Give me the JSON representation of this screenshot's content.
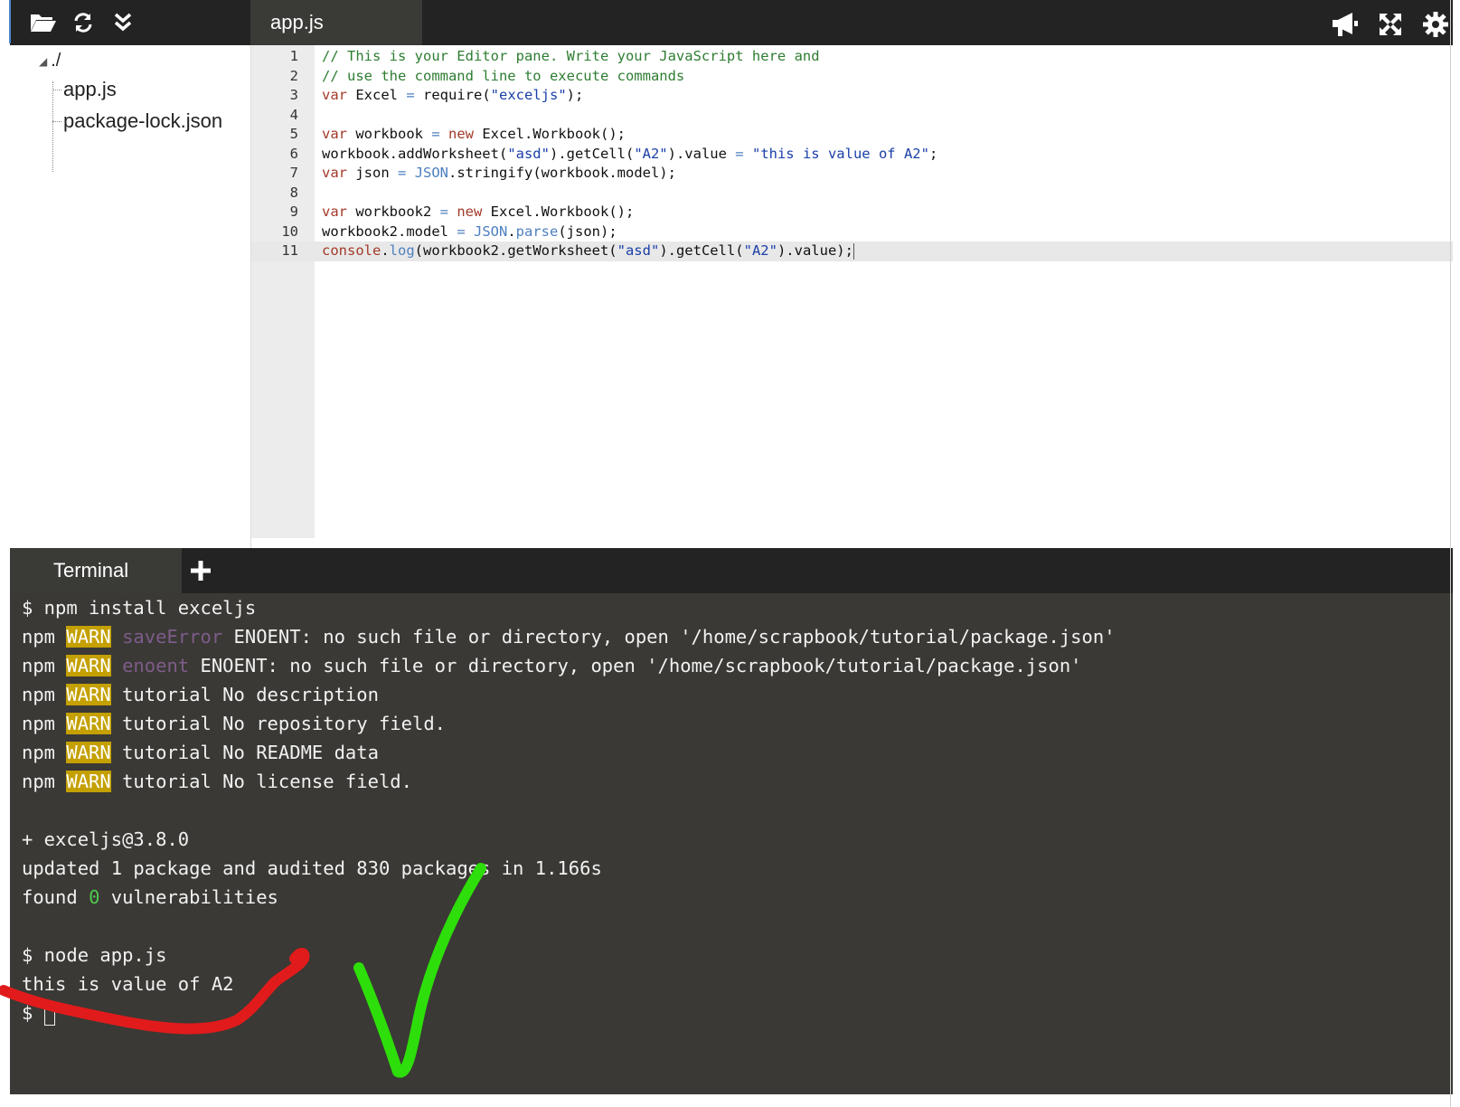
{
  "window": {
    "toolbar_icons": [
      "folder-open-icon",
      "refresh-icon",
      "collapse-down-icon"
    ],
    "top_actions": [
      "megaphone-icon",
      "fullscreen-icon",
      "settings-icon"
    ]
  },
  "editor_tab": {
    "label": "app.js"
  },
  "file_tree": {
    "root": "./",
    "items": [
      "app.js",
      "package-lock.json"
    ]
  },
  "editor": {
    "lines": [
      {
        "n": "1",
        "text": "// This is your Editor pane. Write your JavaScript here and"
      },
      {
        "n": "2",
        "text": "// use the command line to execute commands"
      },
      {
        "n": "3",
        "text": "var Excel = require(\"exceljs\");"
      },
      {
        "n": "4",
        "text": ""
      },
      {
        "n": "5",
        "text": "var workbook = new Excel.Workbook();"
      },
      {
        "n": "6",
        "text": "workbook.addWorksheet(\"asd\").getCell(\"A2\").value = \"this is value of A2\";"
      },
      {
        "n": "7",
        "text": "var json = JSON.stringify(workbook.model);"
      },
      {
        "n": "8",
        "text": ""
      },
      {
        "n": "9",
        "text": "var workbook2 = new Excel.Workbook();"
      },
      {
        "n": "10",
        "text": "workbook2.model = JSON.parse(json);"
      },
      {
        "n": "11",
        "text": "console.log(workbook2.getWorksheet(\"asd\").getCell(\"A2\").value);"
      }
    ],
    "active_line": "11"
  },
  "terminal": {
    "tab_label": "Terminal",
    "add_label": "+",
    "lines": {
      "l1": "$ npm install exceljs",
      "npm": "npm",
      "warn": "WARN",
      "l2_dim": "saveError",
      "l2_rest": " ENOENT: no such file or directory, open '/home/scrapbook/tutorial/package.json'",
      "l3_dim": "enoent",
      "l3_rest": " ENOENT: no such file or directory, open '/home/scrapbook/tutorial/package.json'",
      "l4_rest": " tutorial No description",
      "l5_rest": " tutorial No repository field.",
      "l6_rest": " tutorial No README data",
      "l7_rest": " tutorial No license field.",
      "l8": "+ exceljs@3.8.0",
      "l9": "updated 1 package and audited 830 packages in 1.166s",
      "l10_a": "found ",
      "l10_num": "0",
      "l10_b": " vulnerabilities",
      "l11": "$ node app.js",
      "l12": "this is value of A2",
      "prompt": "$ "
    }
  },
  "annotations": {
    "red_mark_color": "#e11b1b",
    "green_check_color": "#2ede0a"
  }
}
